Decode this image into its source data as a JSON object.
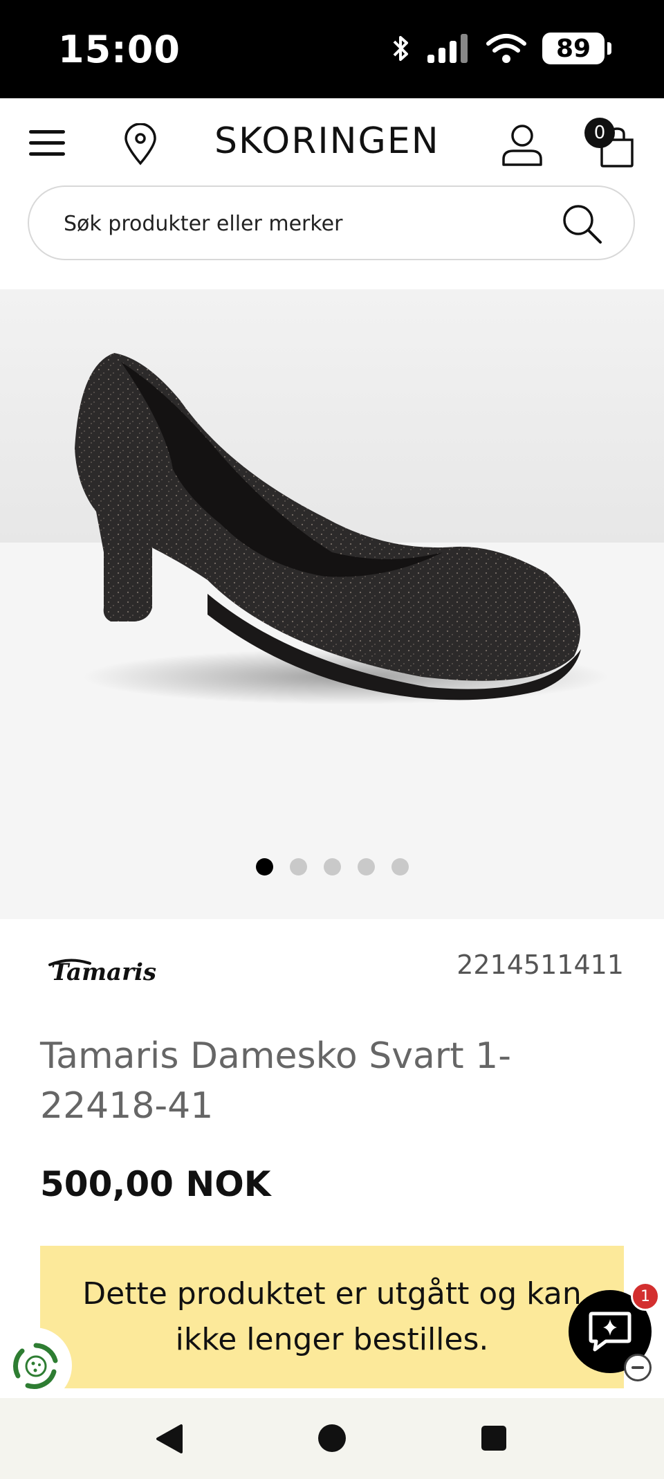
{
  "status_bar": {
    "time": "15:00",
    "battery": "89"
  },
  "header": {
    "brand": "SKORINGEN",
    "cart_count": "0"
  },
  "search": {
    "placeholder": "Søk produkter eller merker"
  },
  "gallery": {
    "image_count": 5,
    "active_index": 0
  },
  "product": {
    "brand_logo": "Tamaris",
    "sku": "2214511411",
    "title": "Tamaris Damesko Svart 1-22418-41",
    "price": "500,00 NOK",
    "discontinued_notice": "Dette produktet er utgått og kan ikke lenger bestilles."
  },
  "chat": {
    "badge_count": "1"
  },
  "colors": {
    "notice_bg": "#fce99a",
    "badge_red": "#d32f2f",
    "eco_green": "#2e7d32"
  }
}
